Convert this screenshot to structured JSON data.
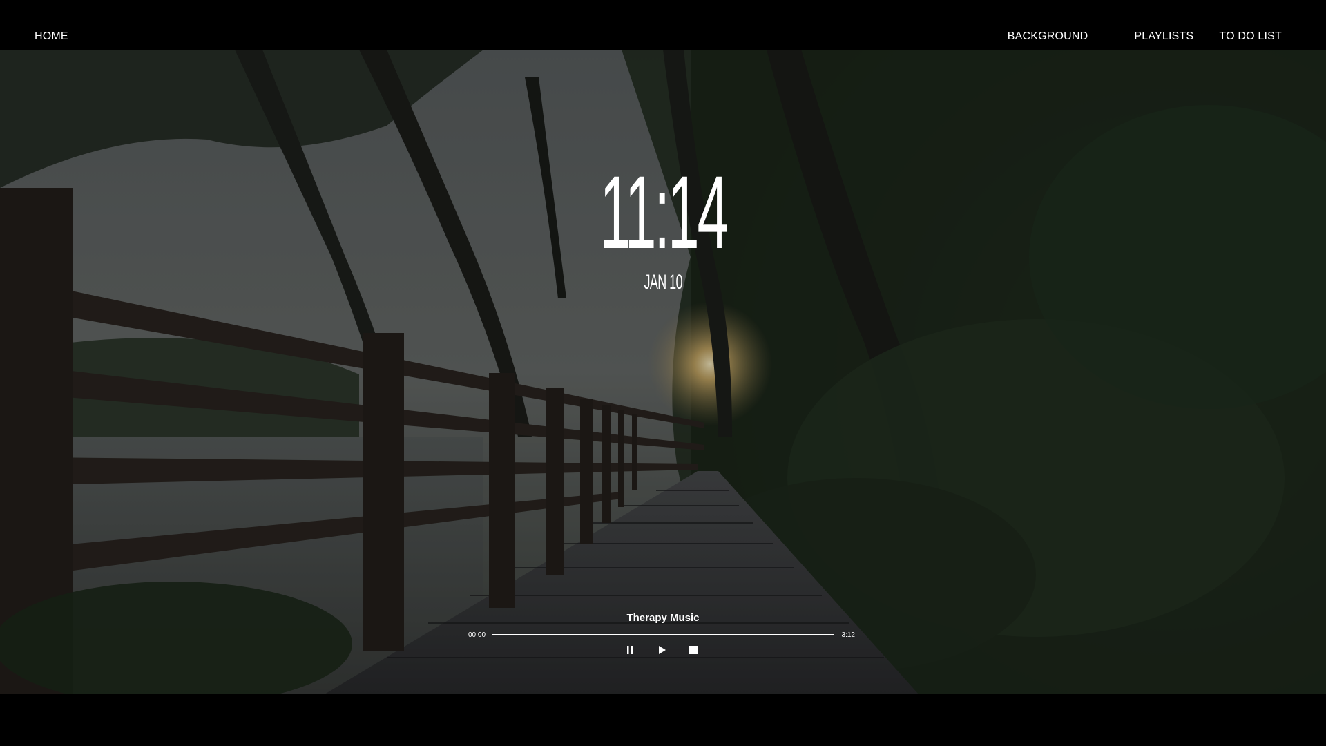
{
  "nav": {
    "home": "HOME",
    "items": [
      "BACKGROUND",
      "PLAYLISTS",
      "TO DO LIST"
    ]
  },
  "background": {
    "theme": "dark forest boardwalk at sunset",
    "icon": "background-image"
  },
  "clock": {
    "time": "11:14",
    "date": "JAN 10"
  },
  "player": {
    "title": "Therapy Music",
    "current_time": "00:00",
    "total_time": "3:12",
    "progress": 0,
    "controls": [
      "pause-icon",
      "play-icon",
      "stop-icon"
    ]
  },
  "colors": {
    "bar": "#000000",
    "text": "#ffffff"
  }
}
